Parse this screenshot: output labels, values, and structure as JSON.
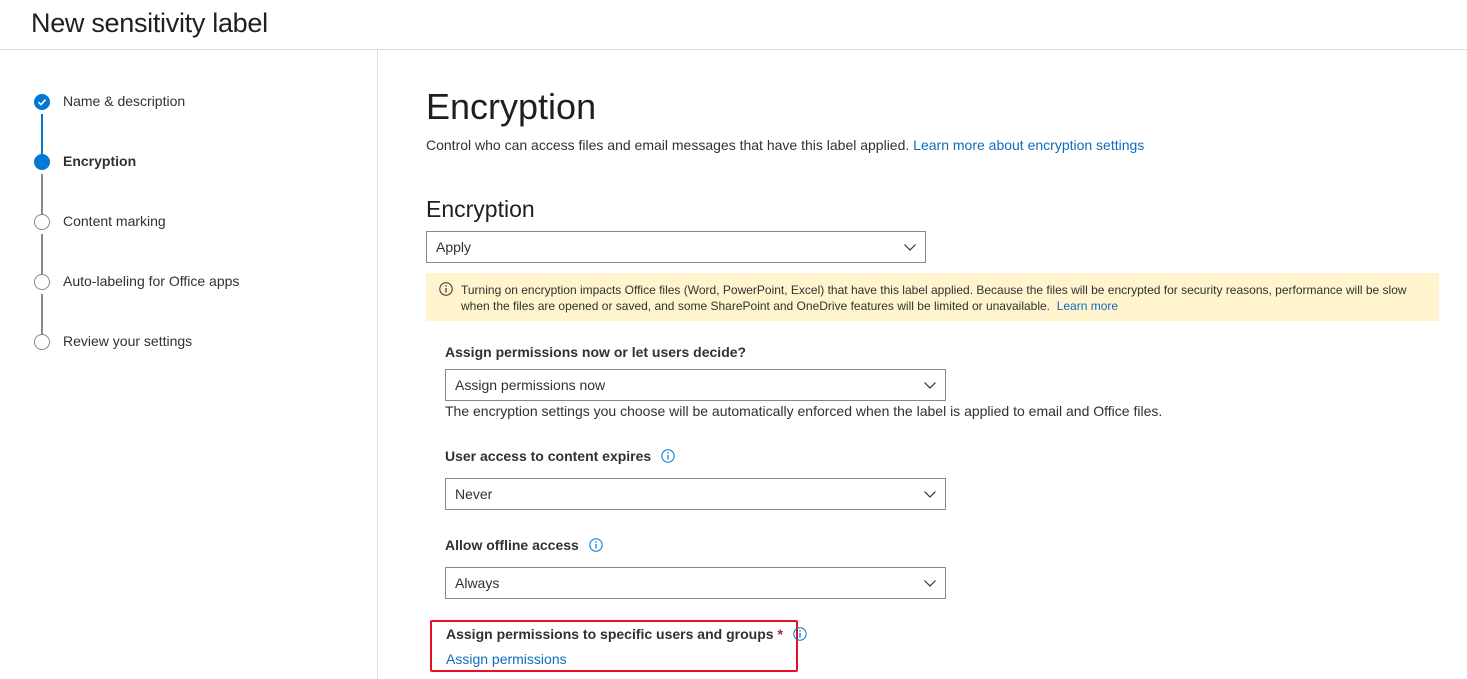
{
  "header": {
    "title": "New sensitivity label"
  },
  "steps": [
    {
      "label": "Name & description",
      "state": "done"
    },
    {
      "label": "Encryption",
      "state": "current"
    },
    {
      "label": "Content marking",
      "state": "pending"
    },
    {
      "label": "Auto-labeling for Office apps",
      "state": "pending"
    },
    {
      "label": "Review your settings",
      "state": "pending"
    }
  ],
  "main": {
    "title": "Encryption",
    "description": "Control who can access files and email messages that have this label applied.",
    "description_link": "Learn more about encryption settings",
    "section_title": "Encryption",
    "encryption_dropdown": {
      "value": "Apply"
    },
    "warning": {
      "text": "Turning on encryption impacts Office files (Word, PowerPoint, Excel) that have this label applied. Because the files will be encrypted for security reasons, performance will be slow when the files are opened or saved, and some SharePoint and OneDrive features will be limited or unavailable.",
      "link": "Learn more"
    },
    "assign_now": {
      "label": "Assign permissions now or let users decide?",
      "value": "Assign permissions now",
      "helper": "The encryption settings you choose will be automatically enforced when the label is applied to email and Office files."
    },
    "expires": {
      "label": "User access to content expires",
      "value": "Never"
    },
    "offline": {
      "label": "Allow offline access",
      "value": "Always"
    },
    "specific": {
      "label": "Assign permissions to specific users and groups",
      "required_mark": "*",
      "link": "Assign permissions"
    }
  },
  "colors": {
    "accent": "#0078d4",
    "link": "#0f6cbd",
    "warning_bg": "#fff4ce",
    "highlight_border": "#e81123",
    "required": "#a4262c"
  },
  "icons": [
    "check-icon",
    "info-icon",
    "chevron-down-icon"
  ]
}
